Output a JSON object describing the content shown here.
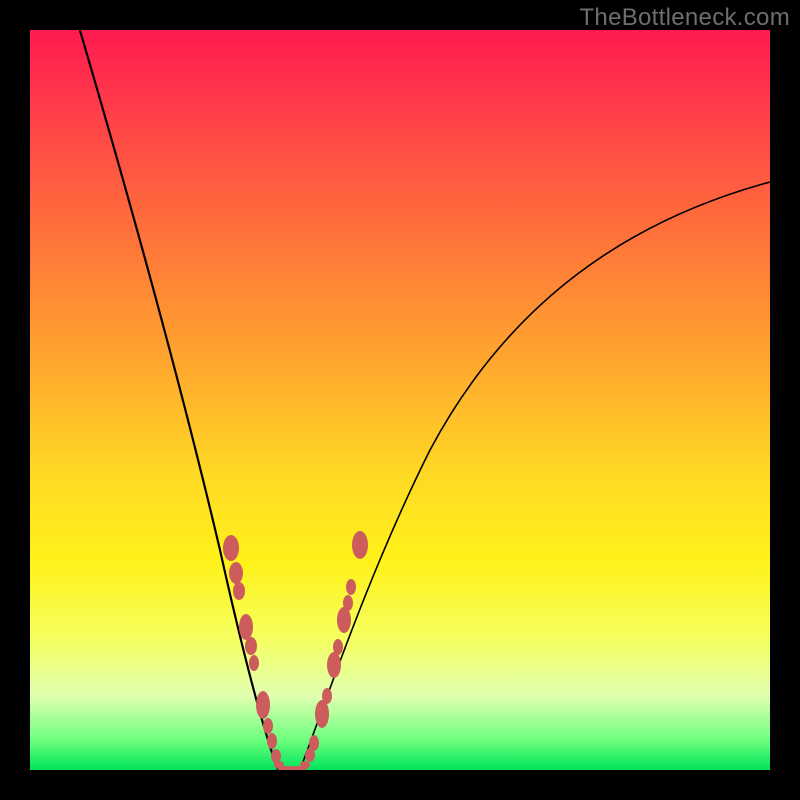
{
  "watermark": {
    "text": "TheBottleneck.com"
  },
  "chart_data": {
    "type": "line",
    "title": "",
    "xlabel": "",
    "ylabel": "",
    "xlim": [
      0,
      100
    ],
    "ylim": [
      0,
      100
    ],
    "gradient_stops": [
      {
        "pos": 0,
        "color": "#ff1a4f"
      },
      {
        "pos": 10,
        "color": "#ff3b4a"
      },
      {
        "pos": 25,
        "color": "#ff6a3c"
      },
      {
        "pos": 45,
        "color": "#ffa72e"
      },
      {
        "pos": 60,
        "color": "#ffd924"
      },
      {
        "pos": 72,
        "color": "#fff21a"
      },
      {
        "pos": 82,
        "color": "#f6ff5e"
      },
      {
        "pos": 90,
        "color": "#e0ffb0"
      },
      {
        "pos": 96,
        "color": "#6cff7d"
      },
      {
        "pos": 100,
        "color": "#00e45a"
      }
    ],
    "series": [
      {
        "name": "left-curve",
        "x": [
          6,
          10,
          14,
          18,
          21,
          24,
          26.5,
          28.5,
          30,
          31,
          32,
          33.5
        ],
        "values": [
          100,
          78,
          58,
          41,
          29,
          19,
          11,
          6,
          3,
          1.2,
          0.3,
          0
        ]
      },
      {
        "name": "right-curve",
        "x": [
          36.5,
          38,
          40,
          43,
          47,
          53,
          61,
          71,
          83,
          97,
          100
        ],
        "values": [
          0,
          0.5,
          2,
          6,
          13,
          23,
          36,
          50,
          64,
          77,
          79.5
        ]
      },
      {
        "name": "valley-floor",
        "x": [
          33.5,
          36.5
        ],
        "values": [
          0,
          0
        ]
      }
    ],
    "markers": {
      "name": "sample-points",
      "color": "#cd5c5c",
      "points": [
        {
          "x": 27.2,
          "y": 30.0
        },
        {
          "x": 27.9,
          "y": 26.6
        },
        {
          "x": 28.3,
          "y": 24.2
        },
        {
          "x": 29.2,
          "y": 19.3
        },
        {
          "x": 29.8,
          "y": 16.7
        },
        {
          "x": 30.3,
          "y": 14.4
        },
        {
          "x": 31.5,
          "y": 8.8
        },
        {
          "x": 32.2,
          "y": 6.0
        },
        {
          "x": 32.7,
          "y": 3.9
        },
        {
          "x": 33.2,
          "y": 1.9
        },
        {
          "x": 33.6,
          "y": 0.6
        },
        {
          "x": 34.3,
          "y": 0.0
        },
        {
          "x": 35.0,
          "y": 0.0
        },
        {
          "x": 35.8,
          "y": 0.0
        },
        {
          "x": 36.5,
          "y": 0.0
        },
        {
          "x": 37.1,
          "y": 0.7
        },
        {
          "x": 37.8,
          "y": 2.0
        },
        {
          "x": 38.4,
          "y": 3.7
        },
        {
          "x": 39.5,
          "y": 7.6
        },
        {
          "x": 40.1,
          "y": 10.0
        },
        {
          "x": 41.1,
          "y": 14.2
        },
        {
          "x": 41.6,
          "y": 16.6
        },
        {
          "x": 42.4,
          "y": 20.3
        },
        {
          "x": 42.9,
          "y": 22.6
        },
        {
          "x": 43.4,
          "y": 24.8
        },
        {
          "x": 44.6,
          "y": 30.4
        }
      ]
    }
  }
}
